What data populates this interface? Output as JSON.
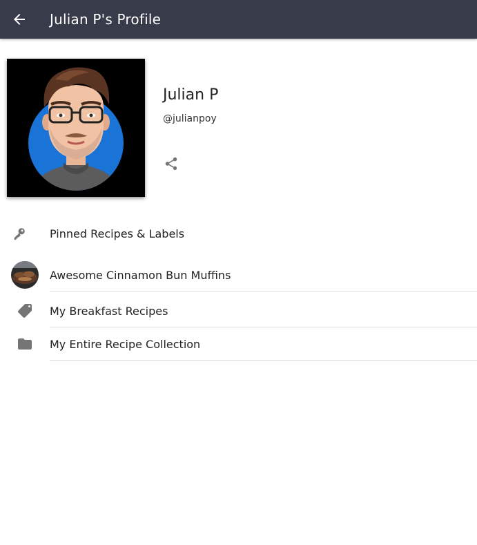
{
  "appbar": {
    "title": "Julian P's Profile",
    "back_icon": "arrow-left-icon",
    "background": "#373b4a"
  },
  "profile": {
    "name": "Julian P",
    "handle": "@julianpoy",
    "avatar_icon": "avatar-caricature",
    "share_icon": "share-icon"
  },
  "pinned_section": {
    "label": "Pinned Recipes & Labels",
    "icon": "key-icon"
  },
  "items": [
    {
      "label": "Awesome Cinnamon Bun Muffins",
      "icon": "recipe-thumbnail"
    },
    {
      "label": "My Breakfast Recipes",
      "icon": "label-tag-icon"
    },
    {
      "label": "My Entire Recipe Collection",
      "icon": "folder-icon"
    }
  ],
  "colors": {
    "appbar": "#373b4a",
    "icon_grey": "#757575",
    "avatar_circle": "#1a73d6",
    "divider": "#dcdcdc"
  }
}
